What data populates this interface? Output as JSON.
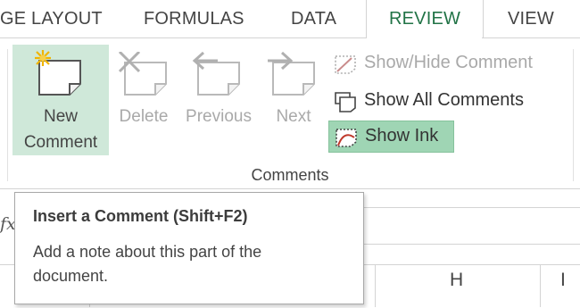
{
  "tabs": [
    {
      "label": "GE LAYOUT",
      "active": false
    },
    {
      "label": "FORMULAS",
      "active": false
    },
    {
      "label": "DATA",
      "active": false
    },
    {
      "label": "REVIEW",
      "active": true
    },
    {
      "label": "VIEW",
      "active": false
    }
  ],
  "comments_group": {
    "label": "Comments",
    "new_comment": {
      "line1": "New",
      "line2": "Comment"
    },
    "delete": "Delete",
    "previous": "Previous",
    "next": "Next",
    "show_hide_comment": "Show/Hide Comment",
    "show_all_comments": "Show All Comments",
    "show_ink": "Show Ink"
  },
  "formula_bar": {
    "fx_label": "fx"
  },
  "columns": [
    "H",
    "I"
  ],
  "tooltip": {
    "title": "Insert a Comment (Shift+F2)",
    "description": "Add a note about this part of the document."
  },
  "colors": {
    "accent": "#217346",
    "highlight": "#cfe8d9",
    "pressed": "#9fd5b4"
  }
}
